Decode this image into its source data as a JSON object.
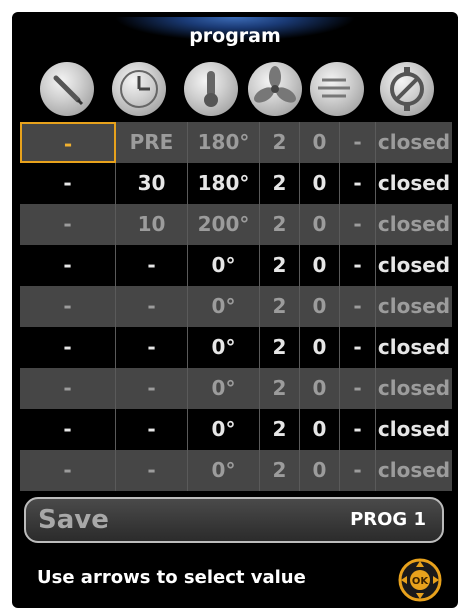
{
  "header": {
    "title": "program"
  },
  "column_icons": [
    "probe-icon",
    "clock-icon",
    "thermometer-icon",
    "fan-icon",
    "air-flow-icon",
    "damper-valve-icon"
  ],
  "rows": [
    [
      "-",
      "PRE",
      "180°",
      "2",
      "0",
      "-",
      "closed"
    ],
    [
      "-",
      "30",
      "180°",
      "2",
      "0",
      "-",
      "closed"
    ],
    [
      "-",
      "10",
      "200°",
      "2",
      "0",
      "-",
      "closed"
    ],
    [
      "-",
      "-",
      "0°",
      "2",
      "0",
      "-",
      "closed"
    ],
    [
      "-",
      "-",
      "0°",
      "2",
      "0",
      "-",
      "closed"
    ],
    [
      "-",
      "-",
      "0°",
      "2",
      "0",
      "-",
      "closed"
    ],
    [
      "-",
      "-",
      "0°",
      "2",
      "0",
      "-",
      "closed"
    ],
    [
      "-",
      "-",
      "0°",
      "2",
      "0",
      "-",
      "closed"
    ],
    [
      "-",
      "-",
      "0°",
      "2",
      "0",
      "-",
      "closed"
    ]
  ],
  "footer": {
    "save_label": "Save",
    "program_label": "PROG 1",
    "hint": "Use arrows to select value",
    "ok_label": "OK"
  },
  "colors": {
    "selection": "#e8a21c",
    "ok_button": "#e8a21c"
  }
}
